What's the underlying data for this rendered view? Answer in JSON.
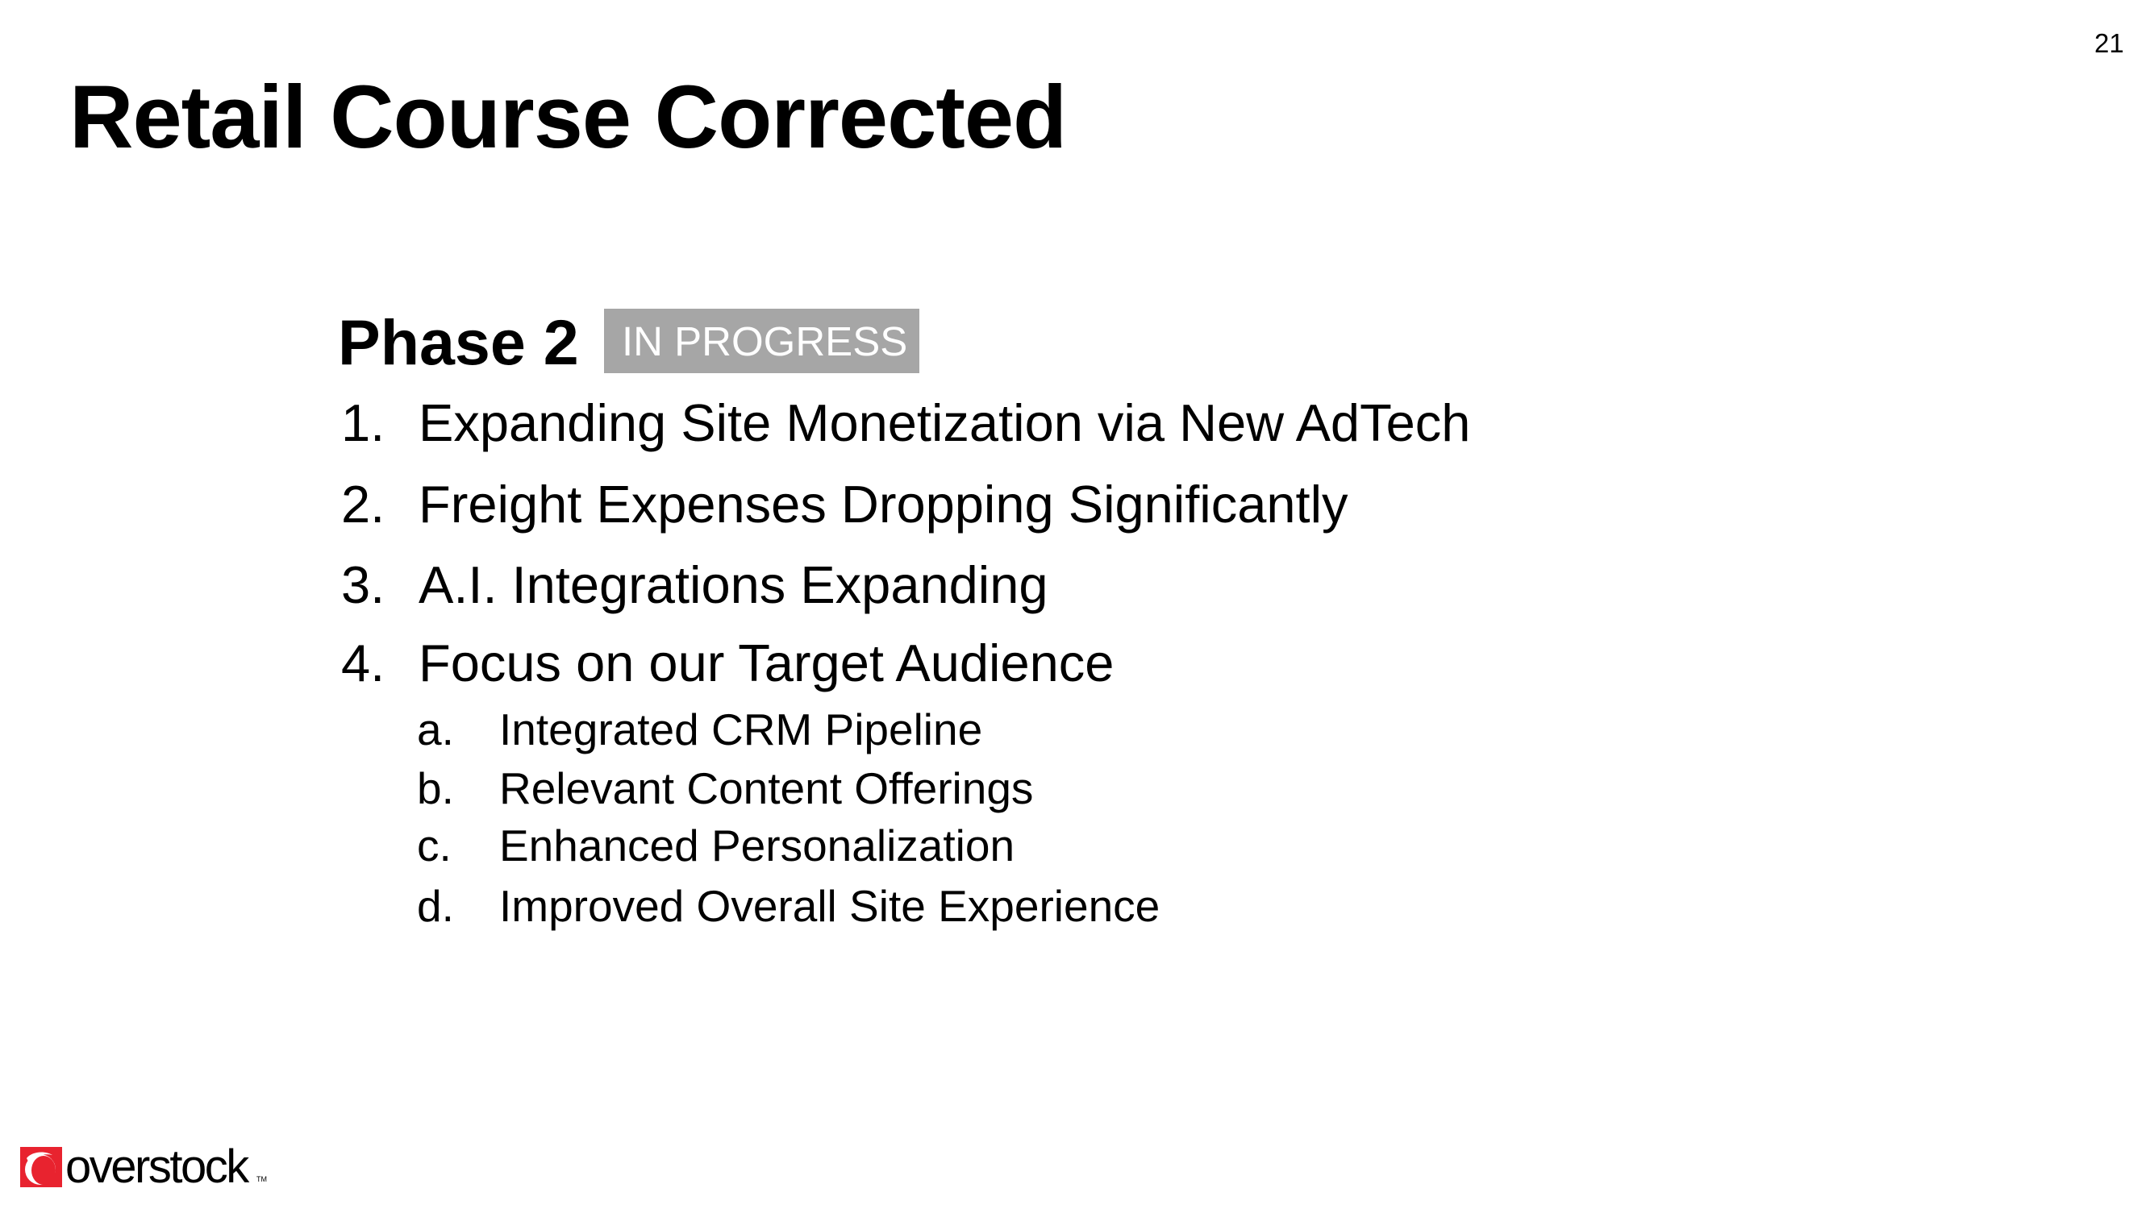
{
  "slide": {
    "page_number": "21",
    "title": "Retail Course Corrected",
    "phase": {
      "heading": "Phase 2",
      "status_badge": "IN PROGRESS",
      "badge_color": "#a6a6a6"
    },
    "items": [
      {
        "marker": "1.",
        "text": "Expanding Site Monetization via New AdTech"
      },
      {
        "marker": "2.",
        "text": "Freight Expenses Dropping Significantly"
      },
      {
        "marker": "3.",
        "text": "A.I. Integrations Expanding"
      },
      {
        "marker": "4.",
        "text": "Focus on our Target Audience",
        "subitems": [
          {
            "marker": "a.",
            "text": "Integrated CRM Pipeline"
          },
          {
            "marker": "b.",
            "text": "Relevant Content Offerings"
          },
          {
            "marker": "c.",
            "text": "Enhanced Personalization"
          },
          {
            "marker": "d.",
            "text": "Improved Overall Site Experience"
          }
        ]
      }
    ]
  },
  "footer": {
    "logo": {
      "icon": "overstock-o-mark-icon",
      "wordmark": "overstock",
      "trademark": "TM",
      "brand_color": "#e8232f"
    }
  }
}
